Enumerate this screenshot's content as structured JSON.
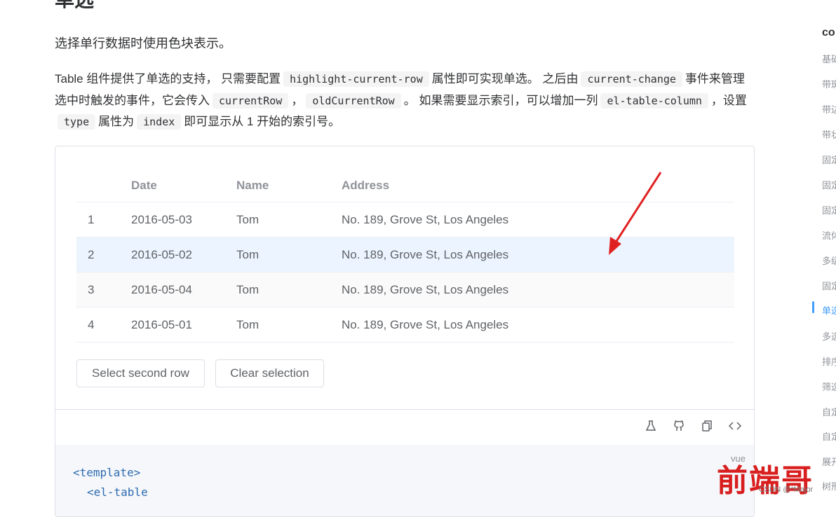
{
  "doc": {
    "title": "单选",
    "lead": "选择单行数据时使用色块表示。",
    "desc_parts": {
      "p1": "Table 组件提供了单选的支持， 只需要配置",
      "c1": "highlight-current-row",
      "p2": "属性即可实现单选。 之后由",
      "c2": "current-change",
      "p3": "事件来管理选中时触发的事件，它会传入",
      "c3": "currentRow",
      "p4": "，",
      "c4": "oldCurrentRow",
      "p5": "。 如果需要显示索引，可以增加一列",
      "c5": "el-table-column",
      "p6": "，设置",
      "c6": "type",
      "p7": "属性为",
      "c7": "index",
      "p8": "即可显示从 1 开始的索引号。"
    }
  },
  "table": {
    "headers": [
      "",
      "Date",
      "Name",
      "Address"
    ],
    "rows": [
      {
        "index": "1",
        "date": "2016-05-03",
        "name": "Tom",
        "address": "No. 189, Grove St, Los Angeles"
      },
      {
        "index": "2",
        "date": "2016-05-02",
        "name": "Tom",
        "address": "No. 189, Grove St, Los Angeles"
      },
      {
        "index": "3",
        "date": "2016-05-04",
        "name": "Tom",
        "address": "No. 189, Grove St, Los Angeles"
      },
      {
        "index": "4",
        "date": "2016-05-01",
        "name": "Tom",
        "address": "No. 189, Grove St, Los Angeles"
      }
    ],
    "current_row": 2
  },
  "buttons": {
    "select_second": "Select second row",
    "clear_selection": "Clear selection"
  },
  "toolbar_icons": [
    "flask-icon",
    "github-icon",
    "copy-icon",
    "code-icon"
  ],
  "code": {
    "lang": "vue",
    "line1": "<template>",
    "line2": "<el-table"
  },
  "toc": {
    "title": "co",
    "items": [
      "基础",
      "带斑",
      "带边",
      "带状",
      "固定",
      "固定",
      "固定",
      "流体",
      "多级",
      "固定",
      "单选",
      "多选",
      "排序",
      "筛选",
      "自定",
      "自定",
      "展开",
      "树形"
    ],
    "active_index": 10
  },
  "watermark": {
    "text": "前端哥",
    "caption": "CSDN @*Major"
  },
  "colors": {
    "accent": "#409eff",
    "current_row_bg": "#ecf5ff",
    "arrow": "#e02020",
    "watermark": "#d81e1e"
  }
}
